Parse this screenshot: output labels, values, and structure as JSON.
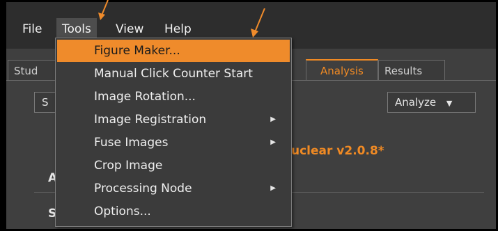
{
  "menubar": {
    "items": [
      "File",
      "Tools",
      "View",
      "Help"
    ]
  },
  "tabs": {
    "partial_left": "Stud",
    "analysis": "Analysis",
    "results": "Results"
  },
  "controls": {
    "partial_button": "S",
    "analyze_label": "Analyze"
  },
  "content": {
    "partial_title": "uclear v2.0.8*",
    "partial_heading": "A",
    "partial_sub": "S"
  },
  "tools_menu": {
    "items": [
      {
        "label": "Figure Maker...",
        "submenu": false
      },
      {
        "label": "Manual Click Counter Start",
        "submenu": false
      },
      {
        "label": "Image Rotation...",
        "submenu": false
      },
      {
        "label": "Image Registration",
        "submenu": true
      },
      {
        "label": "Fuse Images",
        "submenu": true
      },
      {
        "label": "Crop Image",
        "submenu": false
      },
      {
        "label": "Processing Node",
        "submenu": true
      },
      {
        "label": "Options...",
        "submenu": false
      }
    ],
    "highlighted_index": 0
  },
  "colors": {
    "accent": "#ef8b2b",
    "menubar_bg": "#2d2d2d",
    "panel_bg": "#3f3f3f"
  },
  "icons": {
    "submenu": "triangle-right-icon",
    "dropdown": "caret-down-icon",
    "annotation": "arrow-icon"
  }
}
